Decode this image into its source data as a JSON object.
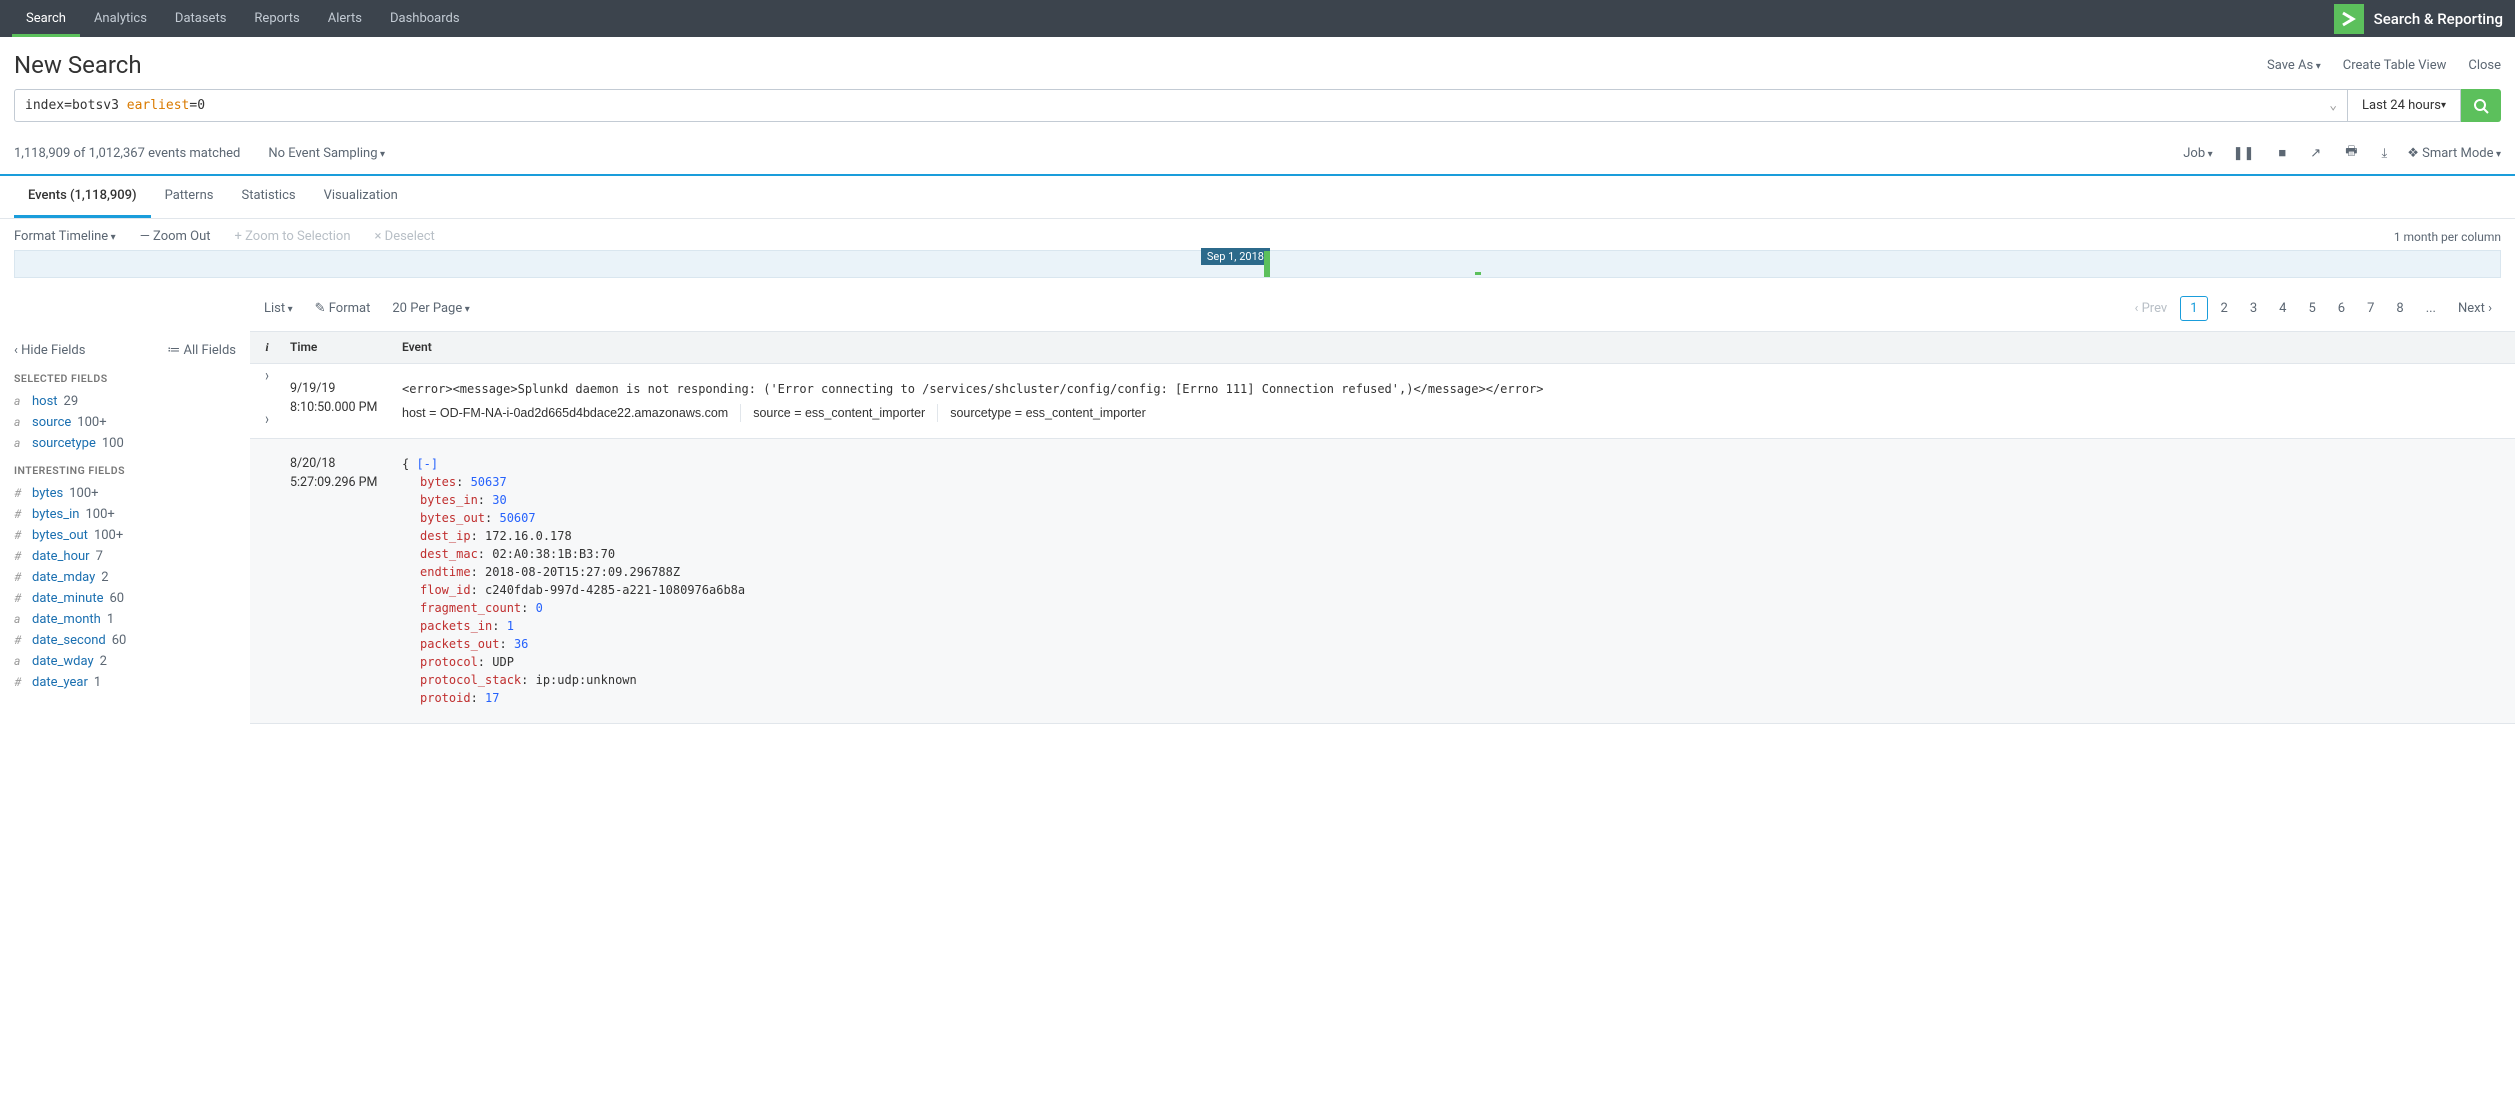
{
  "topnav": {
    "items": [
      "Search",
      "Analytics",
      "Datasets",
      "Reports",
      "Alerts",
      "Dashboards"
    ],
    "app_name": "Search & Reporting"
  },
  "header": {
    "title": "New Search",
    "actions": {
      "save_as": "Save As",
      "create_table": "Create Table View",
      "close": "Close"
    }
  },
  "search": {
    "query_pre": "index=botsv3 ",
    "query_kw": "earliest",
    "query_post": "=0",
    "time": "Last 24 hours"
  },
  "status": {
    "summary": "1,118,909 of 1,012,367 events matched",
    "sampling": "No Event Sampling",
    "job": "Job",
    "smart": "Smart Mode"
  },
  "tabs": {
    "events": "Events (1,118,909)",
    "patterns": "Patterns",
    "statistics": "Statistics",
    "viz": "Visualization"
  },
  "timeline": {
    "format": "Format Timeline",
    "zoomout": "— Zoom Out",
    "zoomsel": "+ Zoom to Selection",
    "deselect": "× Deselect",
    "scale": "1 month per column",
    "marker": "Sep 1, 2018"
  },
  "listctrl": {
    "list": "List",
    "format": "Format",
    "perpage": "20 Per Page",
    "prev": "Prev",
    "next": "Next",
    "pages": [
      "1",
      "2",
      "3",
      "4",
      "5",
      "6",
      "7",
      "8",
      "...",
      "Next"
    ]
  },
  "sidebar": {
    "hide": "Hide Fields",
    "all": "All Fields",
    "selected_title": "SELECTED FIELDS",
    "interesting_title": "INTERESTING FIELDS",
    "selected": [
      {
        "t": "a",
        "name": "host",
        "count": "29"
      },
      {
        "t": "a",
        "name": "source",
        "count": "100+"
      },
      {
        "t": "a",
        "name": "sourcetype",
        "count": "100"
      }
    ],
    "interesting": [
      {
        "t": "#",
        "name": "bytes",
        "count": "100+"
      },
      {
        "t": "#",
        "name": "bytes_in",
        "count": "100+"
      },
      {
        "t": "#",
        "name": "bytes_out",
        "count": "100+"
      },
      {
        "t": "#",
        "name": "date_hour",
        "count": "7"
      },
      {
        "t": "#",
        "name": "date_mday",
        "count": "2"
      },
      {
        "t": "#",
        "name": "date_minute",
        "count": "60"
      },
      {
        "t": "a",
        "name": "date_month",
        "count": "1"
      },
      {
        "t": "#",
        "name": "date_second",
        "count": "60"
      },
      {
        "t": "a",
        "name": "date_wday",
        "count": "2"
      },
      {
        "t": "#",
        "name": "date_year",
        "count": "1"
      }
    ]
  },
  "events_header": {
    "i": "i",
    "time": "Time",
    "event": "Event"
  },
  "events": [
    {
      "date": "9/19/19",
      "time": "8:10:50.000 PM",
      "raw": "<error><message>Splunkd daemon is not responding: ('Error connecting to /services/shcluster/config/config: [Errno 111] Connection refused',)</message></error>",
      "meta": {
        "host_l": "host = ",
        "host_v": "OD-FM-NA-i-0ad2d665d4bdace22.amazonaws.com",
        "source_l": "source = ",
        "source_v": "ess_content_importer",
        "st_l": "sourcetype = ",
        "st_v": "ess_content_importer"
      }
    },
    {
      "date": "8/20/18",
      "time": "5:27:09.296 PM",
      "collapse": "[-]",
      "json": [
        {
          "k": "bytes",
          "v": "50637",
          "num": true
        },
        {
          "k": "bytes_in",
          "v": "30",
          "num": true
        },
        {
          "k": "bytes_out",
          "v": "50607",
          "num": true
        },
        {
          "k": "dest_ip",
          "v": "172.16.0.178"
        },
        {
          "k": "dest_mac",
          "v": "02:A0:38:1B:B3:70"
        },
        {
          "k": "endtime",
          "v": "2018-08-20T15:27:09.296788Z"
        },
        {
          "k": "flow_id",
          "v": "c240fdab-997d-4285-a221-1080976a6b8a"
        },
        {
          "k": "fragment_count",
          "v": "0",
          "num": true
        },
        {
          "k": "packets_in",
          "v": "1",
          "num": true
        },
        {
          "k": "packets_out",
          "v": "36",
          "num": true
        },
        {
          "k": "protocol",
          "v": "UDP"
        },
        {
          "k": "protocol_stack",
          "v": "ip:udp:unknown"
        },
        {
          "k": "protoid",
          "v": "17",
          "num": true
        }
      ]
    }
  ]
}
